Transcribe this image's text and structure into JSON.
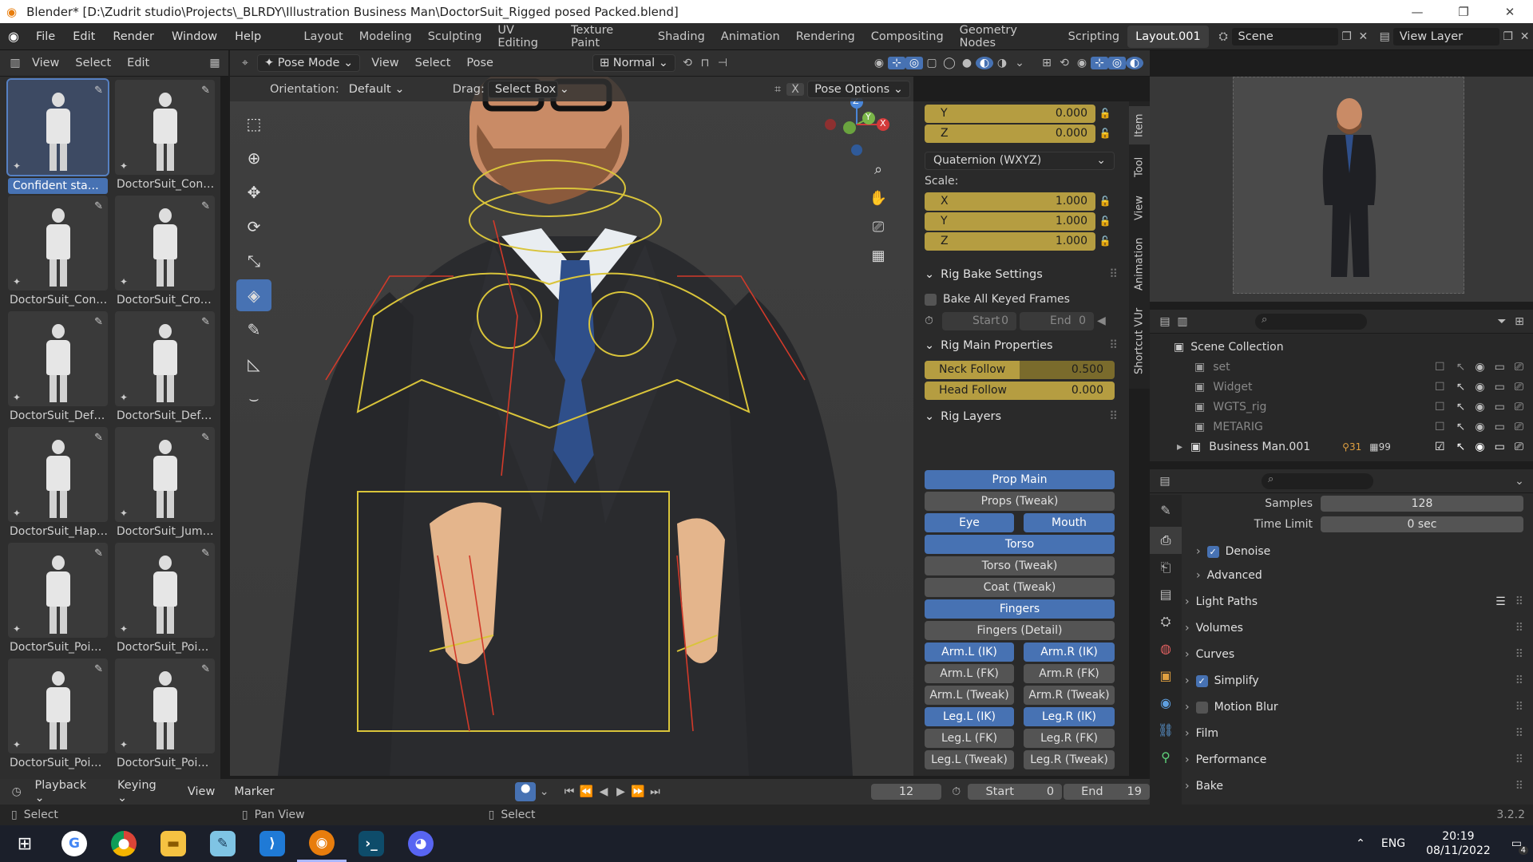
{
  "window": {
    "title": "Blender* [D:\\Zudrit studio\\Projects\\_BLRDY\\Illustration Business Man\\DoctorSuit_Rigged posed Packed.blend]",
    "controls": [
      "—",
      "❐",
      "✕"
    ]
  },
  "menubar": {
    "items": [
      "File",
      "Edit",
      "Render",
      "Window",
      "Help"
    ],
    "workspaces": [
      "Layout",
      "Modeling",
      "Sculpting",
      "UV Editing",
      "Texture Paint",
      "Shading",
      "Animation",
      "Rendering",
      "Compositing",
      "Geometry Nodes",
      "Scripting",
      "Layout.001"
    ],
    "active_workspace": "Layout.001",
    "scene": "Scene",
    "view_layer": "View Layer"
  },
  "asset_browser": {
    "menu": [
      "View",
      "Select",
      "Edit"
    ],
    "assets": [
      {
        "label": "Confident stance",
        "selected": true
      },
      {
        "label": "DoctorSuit_Confid..."
      },
      {
        "label": "DoctorSuit_Confus..."
      },
      {
        "label": "DoctorSuit_Crosse..."
      },
      {
        "label": "DoctorSuit_Defaul..."
      },
      {
        "label": "DoctorSuit_Defaul..."
      },
      {
        "label": "DoctorSuit_Happy"
      },
      {
        "label": "DoctorSuit_Jump ..."
      },
      {
        "label": "DoctorSuit_Pointin..."
      },
      {
        "label": "DoctorSuit_Pointin..."
      },
      {
        "label": "DoctorSuit_Pointin..."
      },
      {
        "label": "DoctorSuit_Pointin..."
      }
    ]
  },
  "viewport_header": {
    "mode": "Pose Mode",
    "menu": [
      "View",
      "Select",
      "Pose"
    ],
    "pivot": "Normal",
    "orientation_label": "Orientation:",
    "orientation": "Default",
    "drag_label": "Drag:",
    "drag": "Select Box",
    "pose_options": "Pose Options",
    "gizmo_axes": [
      "Z",
      "Y",
      "X"
    ]
  },
  "npanel": {
    "transform": {
      "rot_y": {
        "label": "Y",
        "value": "0.000"
      },
      "rot_z": {
        "label": "Z",
        "value": "0.000"
      },
      "rotation_mode": "Quaternion (WXYZ)",
      "scale_label": "Scale:",
      "scale_x": {
        "label": "X",
        "value": "1.000"
      },
      "scale_y": {
        "label": "Y",
        "value": "1.000"
      },
      "scale_z": {
        "label": "Z",
        "value": "1.000"
      }
    },
    "rig_bake": {
      "title": "Rig Bake Settings",
      "bake_all": "Bake All Keyed Frames",
      "start_label": "Start",
      "start": "0",
      "end_label": "End",
      "end": "0"
    },
    "rig_main": {
      "title": "Rig Main Properties",
      "neck_follow": {
        "label": "Neck Follow",
        "value": "0.500",
        "fraction": 0.5
      },
      "head_follow": {
        "label": "Head Follow",
        "value": "0.000",
        "fraction": 0.0
      }
    },
    "rig_layers": {
      "title": "Rig Layers",
      "prop_main": "Prop Main",
      "props_tweak": "Props (Tweak)",
      "eye": "Eye",
      "mouth": "Mouth",
      "torso": "Torso",
      "torso_tweak": "Torso (Tweak)",
      "coat_tweak": "Coat (Tweak)",
      "fingers": "Fingers",
      "fingers_detail": "Fingers (Detail)",
      "arm_l_ik": "Arm.L (IK)",
      "arm_r_ik": "Arm.R (IK)",
      "arm_l_fk": "Arm.L (FK)",
      "arm_r_fk": "Arm.R (FK)",
      "arm_l_tweak": "Arm.L (Tweak)",
      "arm_r_tweak": "Arm.R (Tweak)",
      "leg_l_ik": "Leg.L (IK)",
      "leg_r_ik": "Leg.R (IK)",
      "leg_l_fk": "Leg.L (FK)",
      "leg_r_fk": "Leg.R (FK)",
      "leg_l_tweak": "Leg.L (Tweak)",
      "leg_r_tweak": "Leg.R (Tweak)"
    },
    "tabs": [
      "Item",
      "Tool",
      "View",
      "Animation",
      "Shortcut VUr"
    ]
  },
  "outliner": {
    "root": "Scene Collection",
    "items": [
      {
        "name": "set"
      },
      {
        "name": "Widget"
      },
      {
        "name": "WGTS_rig"
      },
      {
        "name": "METARIG"
      },
      {
        "name": "Business Man.001",
        "badge1": "31",
        "badge2": "99"
      }
    ]
  },
  "properties": {
    "samples_label": "Samples",
    "samples": "128",
    "time_limit_label": "Time Limit",
    "time_limit": "0 sec",
    "sections": [
      {
        "label": "Denoise",
        "check": true,
        "indent": true
      },
      {
        "label": "Advanced",
        "indent": true
      },
      {
        "label": "Light Paths"
      },
      {
        "label": "Volumes"
      },
      {
        "label": "Curves"
      },
      {
        "label": "Simplify",
        "check": true
      },
      {
        "label": "Motion Blur",
        "check": false
      },
      {
        "label": "Film"
      },
      {
        "label": "Performance"
      },
      {
        "label": "Bake"
      }
    ]
  },
  "timeline": {
    "playback": "Playback",
    "keying": "Keying",
    "view": "View",
    "marker": "Marker",
    "current_frame": "12",
    "start_label": "Start",
    "start": "0",
    "end_label": "End",
    "end": "19"
  },
  "statusbar": {
    "left": "Select",
    "middle": "Pan View",
    "right": "Select",
    "version": "3.2.2"
  },
  "taskbar": {
    "lang": "ENG",
    "time": "20:19",
    "date": "08/11/2022",
    "notifications": "4"
  },
  "colors": {
    "accent": "#4772b3",
    "animated_field": "#b59d41",
    "bone_yellow": "#d9c43a",
    "bone_red": "#d23a2a"
  }
}
